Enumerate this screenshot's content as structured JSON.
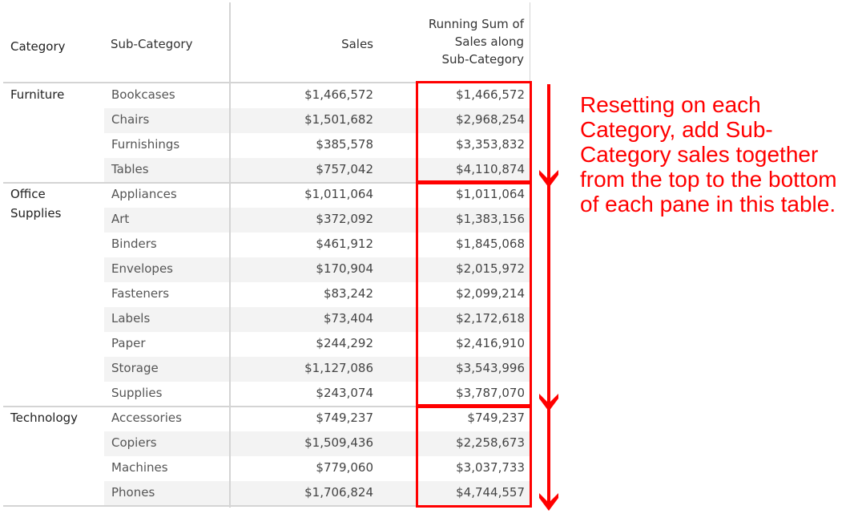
{
  "headers": {
    "category": "Category",
    "sub_category": "Sub-Category",
    "sales": "Sales",
    "running_sum_line1": "Running Sum of",
    "running_sum_line2": "Sales along",
    "running_sum_line3": "Sub-Category"
  },
  "groups": [
    {
      "category": "Furniture",
      "rows": [
        {
          "sub": "Bookcases",
          "sales": "$1,466,572",
          "running": "$1,466,572"
        },
        {
          "sub": "Chairs",
          "sales": "$1,501,682",
          "running": "$2,968,254"
        },
        {
          "sub": "Furnishings",
          "sales": "$385,578",
          "running": "$3,353,832"
        },
        {
          "sub": "Tables",
          "sales": "$757,042",
          "running": "$4,110,874"
        }
      ]
    },
    {
      "category": "Office Supplies",
      "rows": [
        {
          "sub": "Appliances",
          "sales": "$1,011,064",
          "running": "$1,011,064"
        },
        {
          "sub": "Art",
          "sales": "$372,092",
          "running": "$1,383,156"
        },
        {
          "sub": "Binders",
          "sales": "$461,912",
          "running": "$1,845,068"
        },
        {
          "sub": "Envelopes",
          "sales": "$170,904",
          "running": "$2,015,972"
        },
        {
          "sub": "Fasteners",
          "sales": "$83,242",
          "running": "$2,099,214"
        },
        {
          "sub": "Labels",
          "sales": "$73,404",
          "running": "$2,172,618"
        },
        {
          "sub": "Paper",
          "sales": "$244,292",
          "running": "$2,416,910"
        },
        {
          "sub": "Storage",
          "sales": "$1,127,086",
          "running": "$3,543,996"
        },
        {
          "sub": "Supplies",
          "sales": "$243,074",
          "running": "$3,787,070"
        }
      ]
    },
    {
      "category": "Technology",
      "rows": [
        {
          "sub": "Accessories",
          "sales": "$749,237",
          "running": "$749,237"
        },
        {
          "sub": "Copiers",
          "sales": "$1,509,436",
          "running": "$2,258,673"
        },
        {
          "sub": "Machines",
          "sales": "$779,060",
          "running": "$3,037,733"
        },
        {
          "sub": "Phones",
          "sales": "$1,706,824",
          "running": "$4,744,557"
        }
      ]
    }
  ],
  "annotation": {
    "text": "Resetting on each Category, add Sub-Category sales together from the top to the bottom of each pane in this table.",
    "color": "#ff0000"
  },
  "colors": {
    "highlight": "#ff0000",
    "band": "#f3f3f3",
    "grid": "#d4d4d4"
  }
}
